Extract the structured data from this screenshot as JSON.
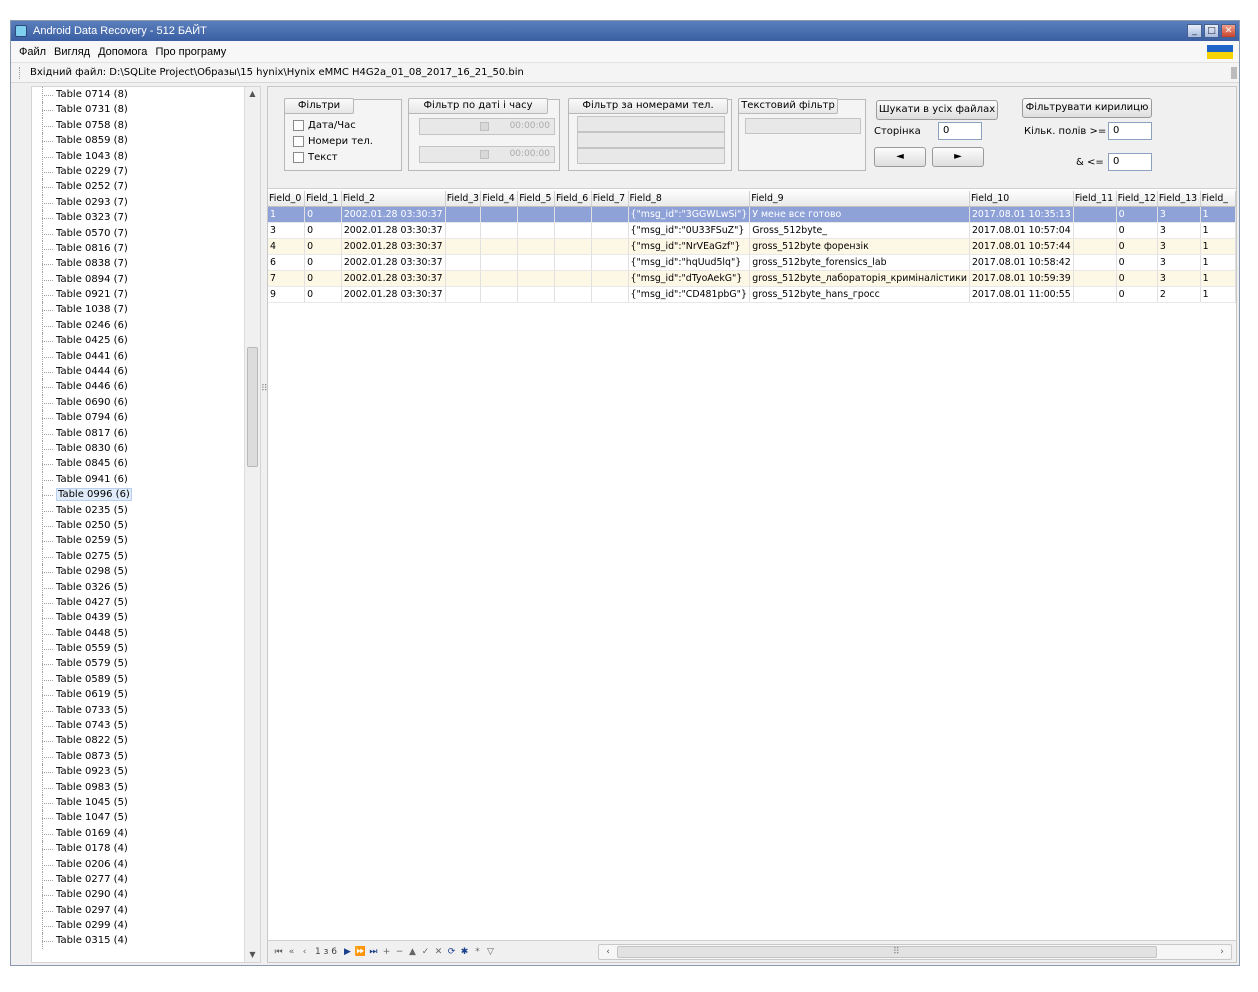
{
  "window": {
    "title": "Android Data Recovery - 512 БАЙТ",
    "minimize": "_",
    "maximize": "□",
    "close": "✕"
  },
  "menu": [
    "Файл",
    "Вигляд",
    "Допомога",
    "Про програму"
  ],
  "filebar": {
    "label": "Вхідний файл: D:\\SQLite Project\\Образы\\15 hynix\\Hynix eMMC H4G2a_01_08_2017_16_21_50.bin"
  },
  "tree": {
    "items": [
      "Table 0714 (8)",
      "Table 0731 (8)",
      "Table 0758 (8)",
      "Table 0859 (8)",
      "Table 1043 (8)",
      "Table 0229 (7)",
      "Table 0252 (7)",
      "Table 0293 (7)",
      "Table 0323 (7)",
      "Table 0570 (7)",
      "Table 0816 (7)",
      "Table 0838 (7)",
      "Table 0894 (7)",
      "Table 0921 (7)",
      "Table 1038 (7)",
      "Table 0246 (6)",
      "Table 0425 (6)",
      "Table 0441 (6)",
      "Table 0444 (6)",
      "Table 0446 (6)",
      "Table 0690 (6)",
      "Table 0794 (6)",
      "Table 0817 (6)",
      "Table 0830 (6)",
      "Table 0845 (6)",
      "Table 0941 (6)",
      "Table 0996 (6)",
      "Table 0235 (5)",
      "Table 0250 (5)",
      "Table 0259 (5)",
      "Table 0275 (5)",
      "Table 0298 (5)",
      "Table 0326 (5)",
      "Table 0427 (5)",
      "Table 0439 (5)",
      "Table 0448 (5)",
      "Table 0559 (5)",
      "Table 0579 (5)",
      "Table 0589 (5)",
      "Table 0619 (5)",
      "Table 0733 (5)",
      "Table 0743 (5)",
      "Table 0822 (5)",
      "Table 0873 (5)",
      "Table 0923 (5)",
      "Table 0983 (5)",
      "Table 1045 (5)",
      "Table 1047 (5)",
      "Table 0169 (4)",
      "Table 0178 (4)",
      "Table 0206 (4)",
      "Table 0277 (4)",
      "Table 0290 (4)",
      "Table 0297 (4)",
      "Table 0299 (4)",
      "Table 0315 (4)"
    ],
    "selected_index": 26
  },
  "filters": {
    "group_filters": "Фільтри",
    "opt_datetime": "Дата/Час",
    "opt_phones": "Номери тел.",
    "opt_text": "Текст",
    "group_date": "Фільтр по даті і часу",
    "time1": "00:00:00",
    "time2": "00:00:00",
    "group_phone": "Фільтр за номерами тел.",
    "group_text": "Текстовий фільтр",
    "search_all": "Шукати в усіх файлах",
    "filter_cyrillic": "Фільтрувати кирилицю",
    "page_label": "Сторінка",
    "page_value": "0",
    "prev": "◄",
    "next": "►",
    "fields_ge_label": "Кільк. полів >=",
    "fields_ge_value": "0",
    "fields_le_label": "& <=",
    "fields_le_value": "0"
  },
  "grid": {
    "columns": [
      "Field_0",
      "Field_1",
      "Field_2",
      "Field_3",
      "Field_4",
      "Field_5",
      "Field_6",
      "Field_7",
      "Field_8",
      "Field_9",
      "Field_10",
      "Field_11",
      "Field_12",
      "Field_13",
      "Field_"
    ],
    "rows": [
      [
        "1",
        "0",
        "2002.01.28 03:30:37",
        "",
        "",
        "",
        "",
        "",
        "{\"msg_id\":\"3GGWLwSi\"}",
        "У мене все готово",
        "2017.08.01 10:35:13",
        "",
        "0",
        "3",
        "1"
      ],
      [
        "3",
        "0",
        "2002.01.28 03:30:37",
        "",
        "",
        "",
        "",
        "",
        "{\"msg_id\":\"0U33FSuZ\"}",
        "Gross_512byte_",
        "2017.08.01 10:57:04",
        "",
        "0",
        "3",
        "1"
      ],
      [
        "4",
        "0",
        "2002.01.28 03:30:37",
        "",
        "",
        "",
        "",
        "",
        "{\"msg_id\":\"NrVEaGzf\"}",
        "gross_512byte форензік",
        "2017.08.01 10:57:44",
        "",
        "0",
        "3",
        "1"
      ],
      [
        "6",
        "0",
        "2002.01.28 03:30:37",
        "",
        "",
        "",
        "",
        "",
        "{\"msg_id\":\"hqUud5lq\"}",
        "gross_512byte_forensics_lab",
        "2017.08.01 10:58:42",
        "",
        "0",
        "3",
        "1"
      ],
      [
        "7",
        "0",
        "2002.01.28 03:30:37",
        "",
        "",
        "",
        "",
        "",
        "{\"msg_id\":\"dTyoAekG\"}",
        "gross_512byte_лабораторія_криміналістики",
        "2017.08.01 10:59:39",
        "",
        "0",
        "3",
        "1"
      ],
      [
        "9",
        "0",
        "2002.01.28 03:30:37",
        "",
        "",
        "",
        "",
        "",
        "{\"msg_id\":\"CD481pbG\"}",
        "gross_512byte_hans_гросс",
        "2017.08.01 11:00:55",
        "",
        "0",
        "2",
        "1"
      ]
    ],
    "selected_row": 0
  },
  "navbar": {
    "first": "⏮",
    "prev_page": "«",
    "prev": "‹",
    "position": "1 з 6",
    "next": "▶",
    "next_page": "⏩",
    "last": "⏭",
    "add": "+",
    "remove": "−",
    "up": "▲",
    "check": "✓",
    "cancel": "✕",
    "refresh": "⟳",
    "star": "✱",
    "star2": "*",
    "filter": "▽",
    "scroll_left": "‹",
    "scroll_right": "›"
  }
}
